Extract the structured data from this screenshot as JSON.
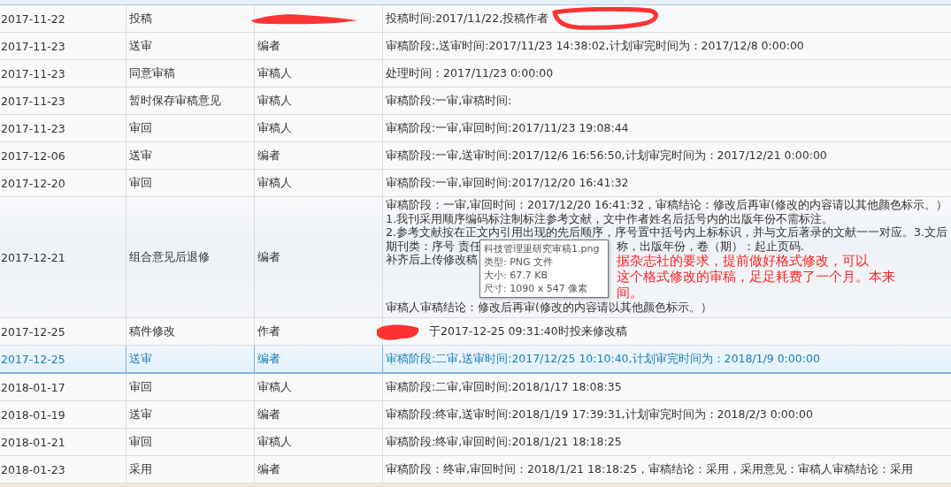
{
  "rows": [
    {
      "kind": "simple",
      "date": "2017-11-22",
      "action": "投稿",
      "detail": "投稿时间:2017/11/22,投稿作者",
      "selected": false,
      "role_redacted": true,
      "detail_redacted": false,
      "detail_circled": true
    },
    {
      "kind": "simple",
      "date": "2017-11-23",
      "action": "送审",
      "role": "编者",
      "detail": "审稿阶段:,送审时间:2017/11/23 14:38:02,计划审完时间为：2017/12/8 0:00:00",
      "selected": false,
      "role_redacted": false,
      "detail_redacted": false,
      "detail_circled": false
    },
    {
      "kind": "simple",
      "date": "2017-11-23",
      "action": "同意审稿",
      "role": "审稿人",
      "detail": "处理时间：2017/11/23 0:00:00",
      "selected": false,
      "role_redacted": false,
      "detail_redacted": false,
      "detail_circled": false
    },
    {
      "kind": "simple",
      "date": "2017-11-23",
      "action": "暂时保存审稿意见",
      "role": "审稿人",
      "detail": "审稿阶段:一审,审稿时间:",
      "selected": false,
      "role_redacted": false,
      "detail_redacted": false,
      "detail_circled": false
    },
    {
      "kind": "simple",
      "date": "2017-11-23",
      "action": "审回",
      "role": "审稿人",
      "detail": "审稿阶段:一审,审回时间:2017/11/23 19:08:44",
      "selected": false,
      "role_redacted": false,
      "detail_redacted": false,
      "detail_circled": false
    },
    {
      "kind": "simple",
      "date": "2017-12-06",
      "action": "送审",
      "role": "编者",
      "detail": "审稿阶段:一审,送审时间:2017/12/6 16:56:50,计划审完时间为：2017/12/21 0:00:00",
      "selected": false,
      "role_redacted": false,
      "detail_redacted": false,
      "detail_circled": false
    },
    {
      "kind": "simple",
      "date": "2017-12-20",
      "action": "审回",
      "role": "审稿人",
      "detail": "审稿阶段:一审,审回时间:2017/12/20 16:41:32",
      "selected": false,
      "role_redacted": false,
      "detail_redacted": false,
      "detail_circled": false
    },
    {
      "kind": "multiline",
      "date": "2017-12-21",
      "action": "组合意见后退修",
      "role": "编者",
      "selected": false,
      "role_redacted": false,
      "detail_redacted": false,
      "detail_circled": false,
      "detail_lines": [
        {
          "kind": "full",
          "text": "审稿阶段：一审,审回时间：2017/12/20 16:41:32，审稿结论：修改后再审(修改的内容请以其他颜色标示。）"
        },
        {
          "kind": "full",
          "text": "1.我刊采用顺序编码标注制标注参考文献，文中作者姓名后括号内的出版年份不需标注。"
        },
        {
          "kind": "full",
          "text": "2.参考文献按在正文内引用出现的先后顺序，序号置中括号内上标标识，并与文后著录的文献一一对应。3.文后"
        },
        {
          "kind": "split",
          "text": "期刊类：序号 责任",
          "after": "称，出版年份，卷（期）：起止页码."
        },
        {
          "kind": "split",
          "text": "补齐后上传修改稿",
          "note": "据杂志社的要求，提前做好格式修改，可以"
        },
        {
          "kind": "split",
          "note": "这个格式修改的审稿，足足耗费了一个月。本来"
        },
        {
          "kind": "split",
          "note": "间。"
        },
        {
          "kind": "full",
          "text": "审稿人审稿结论：修改后再审(修改的内容请以其他颜色标示。）"
        }
      ],
      "tooltip": [
        "科技管理里研究审稿1.png",
        "类型: PNG 文件",
        "大小: 67.7 KB",
        "尺寸: 1090 x 547 像素"
      ]
    },
    {
      "kind": "simple",
      "date": "2017-12-25",
      "action": "稿件修改",
      "role": "作者",
      "detail": "于2017-12-25 09:31:40时投来修改稿",
      "selected": false,
      "role_redacted": false,
      "detail_redacted": true,
      "detail_circled": false
    },
    {
      "kind": "simple",
      "date": "2017-12-25",
      "action": "送审",
      "role": "编者",
      "detail": "审稿阶段:二审,送审时间:2017/12/25 10:10:40,计划审完时间为：2018/1/9 0:00:00",
      "selected": true,
      "role_redacted": false,
      "detail_redacted": false,
      "detail_circled": false
    },
    {
      "kind": "simple",
      "date": "2018-01-17",
      "action": "审回",
      "role": "审稿人",
      "detail": "审稿阶段:二审,审回时间:2018/1/17 18:08:35",
      "selected": false,
      "role_redacted": false,
      "detail_redacted": false,
      "detail_circled": false
    },
    {
      "kind": "simple",
      "date": "2018-01-19",
      "action": "送审",
      "role": "编者",
      "detail": "审稿阶段:终审,送审时间:2018/1/19 17:39:31,计划审完时间为：2018/2/3 0:00:00",
      "selected": false,
      "role_redacted": false,
      "detail_redacted": false,
      "detail_circled": false
    },
    {
      "kind": "simple",
      "date": "2018-01-21",
      "action": "审回",
      "role": "审稿人",
      "detail": "审稿阶段:终审,审回时间:2018/1/21 18:18:25",
      "selected": false,
      "role_redacted": false,
      "detail_redacted": false,
      "detail_circled": false
    },
    {
      "kind": "simple",
      "date": "2018-01-23",
      "action": "采用",
      "role": "编者",
      "detail": "审稿阶段：终审,审回时间：2018/1/21 18:18:25，审稿结论：采用，采用意见：审稿人审稿结论：采用",
      "selected": false,
      "role_redacted": false,
      "detail_redacted": false,
      "detail_circled": false
    }
  ]
}
